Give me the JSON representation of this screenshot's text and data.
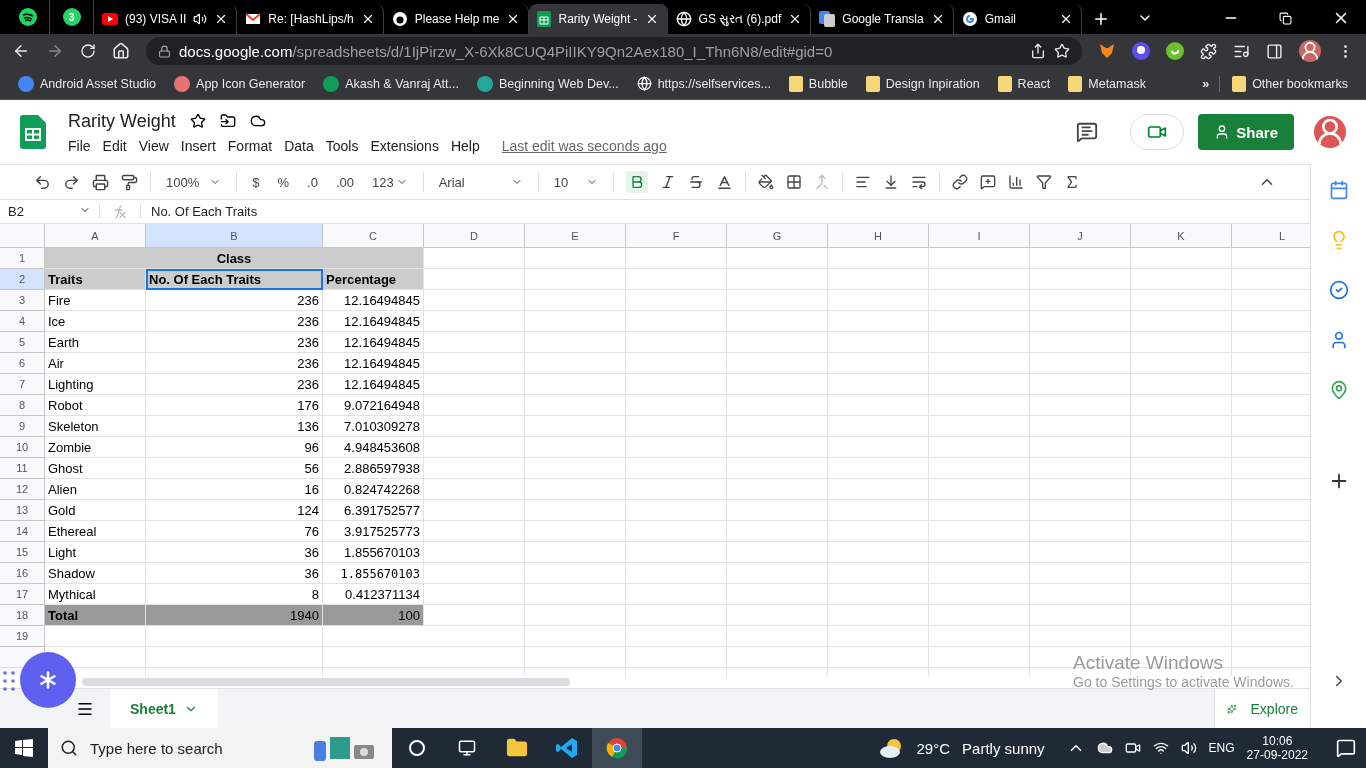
{
  "browser": {
    "pinned_tabs": [
      {
        "kind": "music"
      },
      {
        "kind": "chat",
        "badge": "3"
      }
    ],
    "tabs": [
      {
        "title": "(93) VISA II",
        "audio": true,
        "selected": false
      },
      {
        "title": "Re: [HashLips/h",
        "audio": false,
        "selected": false
      },
      {
        "title": "Please Help me",
        "audio": false,
        "selected": false
      },
      {
        "title": "Rarity Weight -",
        "audio": false,
        "selected": true
      },
      {
        "title": "GS સુરત (6).pdf",
        "audio": false,
        "selected": false
      },
      {
        "title": "Google Transla",
        "audio": false,
        "selected": false
      },
      {
        "title": "Gmail",
        "audio": false,
        "selected": false
      }
    ],
    "address": {
      "domain": "docs.google.com",
      "path": "/spreadsheets/d/1IjPirzw_X-6Xk8CUQ4PiIIKY9Qn2Aex180_I_Thn6N8/edit#gid=0"
    },
    "bookmarks": [
      {
        "label": "Android Asset Studio"
      },
      {
        "label": "App Icon Generator"
      },
      {
        "label": "Akash & Vanraj Att..."
      },
      {
        "label": "Beginning Web Dev..."
      },
      {
        "label": "https://selfservices..."
      },
      {
        "label": "Bubble"
      },
      {
        "label": "Design Inpiration"
      },
      {
        "label": "React"
      },
      {
        "label": "Metamask"
      }
    ],
    "bookmarks_overflow": "»",
    "other_bookmarks": "Other bookmarks"
  },
  "sheet": {
    "title": "Rarity Weight",
    "menu": [
      "File",
      "Edit",
      "View",
      "Insert",
      "Format",
      "Data",
      "Tools",
      "Extensions",
      "Help"
    ],
    "last_edit": "Last edit was seconds ago",
    "share": "Share",
    "toolbar": {
      "zoom": "100%",
      "currency": "$",
      "percent": "%",
      "decrease_decimals": ".0",
      "increase_decimals": ".00",
      "more_formats": "123",
      "font": "Arial",
      "font_size": "10",
      "bold": true
    },
    "name_box": "B2",
    "formula": "No. Of Each Traits",
    "columns": [
      {
        "label": "A",
        "selected": false
      },
      {
        "label": "B",
        "selected": true
      },
      {
        "label": "C",
        "selected": false
      },
      {
        "label": "D",
        "selected": false
      },
      {
        "label": "E",
        "selected": false
      },
      {
        "label": "F",
        "selected": false
      },
      {
        "label": "G",
        "selected": false
      },
      {
        "label": "H",
        "selected": false
      },
      {
        "label": "I",
        "selected": false
      },
      {
        "label": "J",
        "selected": false
      },
      {
        "label": "K",
        "selected": false
      },
      {
        "label": "L",
        "selected": false
      }
    ],
    "rows": [
      {
        "num": "1",
        "kind": "title",
        "selected": false,
        "cells": [
          "Class"
        ]
      },
      {
        "num": "2",
        "kind": "header",
        "selected": true,
        "cells": [
          "Traits",
          "No. Of Each Traits",
          "Percentage"
        ]
      },
      {
        "num": "3",
        "kind": "data",
        "selected": false,
        "cells": [
          "Fire",
          "236",
          "12.16494845"
        ]
      },
      {
        "num": "4",
        "kind": "data",
        "selected": false,
        "cells": [
          "Ice",
          "236",
          "12.16494845"
        ]
      },
      {
        "num": "5",
        "kind": "data",
        "selected": false,
        "cells": [
          "Earth",
          "236",
          "12.16494845"
        ]
      },
      {
        "num": "6",
        "kind": "data",
        "selected": false,
        "cells": [
          "Air",
          "236",
          "12.16494845"
        ]
      },
      {
        "num": "7",
        "kind": "data",
        "selected": false,
        "cells": [
          "Lighting",
          "236",
          "12.16494845"
        ]
      },
      {
        "num": "8",
        "kind": "data",
        "selected": false,
        "cells": [
          "Robot",
          "176",
          "9.072164948"
        ]
      },
      {
        "num": "9",
        "kind": "data",
        "selected": false,
        "cells": [
          "Skeleton",
          "136",
          "7.010309278"
        ]
      },
      {
        "num": "10",
        "kind": "data",
        "selected": false,
        "cells": [
          "Zombie",
          "96",
          "4.948453608"
        ]
      },
      {
        "num": "11",
        "kind": "data",
        "selected": false,
        "cells": [
          "Ghost",
          "56",
          "2.886597938"
        ]
      },
      {
        "num": "12",
        "kind": "data",
        "selected": false,
        "cells": [
          "Alien",
          "16",
          "0.824742268"
        ]
      },
      {
        "num": "13",
        "kind": "data",
        "selected": false,
        "cells": [
          "Gold",
          "124",
          "6.391752577"
        ]
      },
      {
        "num": "14",
        "kind": "data",
        "selected": false,
        "cells": [
          "Ethereal",
          "76",
          "3.917525773"
        ]
      },
      {
        "num": "15",
        "kind": "data",
        "selected": false,
        "cells": [
          "Light",
          "36",
          "1.855670103"
        ]
      },
      {
        "num": "16",
        "kind": "data_mono",
        "selected": false,
        "cells": [
          "Shadow",
          "36",
          "1.855670103"
        ]
      },
      {
        "num": "17",
        "kind": "data",
        "selected": false,
        "cells": [
          "Mythical",
          "8",
          "0.412371134"
        ]
      },
      {
        "num": "18",
        "kind": "total",
        "selected": false,
        "cells": [
          "Total",
          "1940",
          "100"
        ]
      },
      {
        "num": "19",
        "kind": "data",
        "selected": false
      }
    ],
    "sheet_tabs": [
      {
        "label": "Sheet1",
        "selected": true
      }
    ],
    "explore": "Explore"
  },
  "os_notice": {
    "title": "Activate Windows",
    "text": "Go to Settings to activate Windows."
  },
  "taskbar": {
    "search_placeholder": "Type here to search",
    "temperature": "29°C",
    "weather": "Partly sunny",
    "language": "ENG",
    "time": "10:06",
    "date": "27-09-2022"
  }
}
